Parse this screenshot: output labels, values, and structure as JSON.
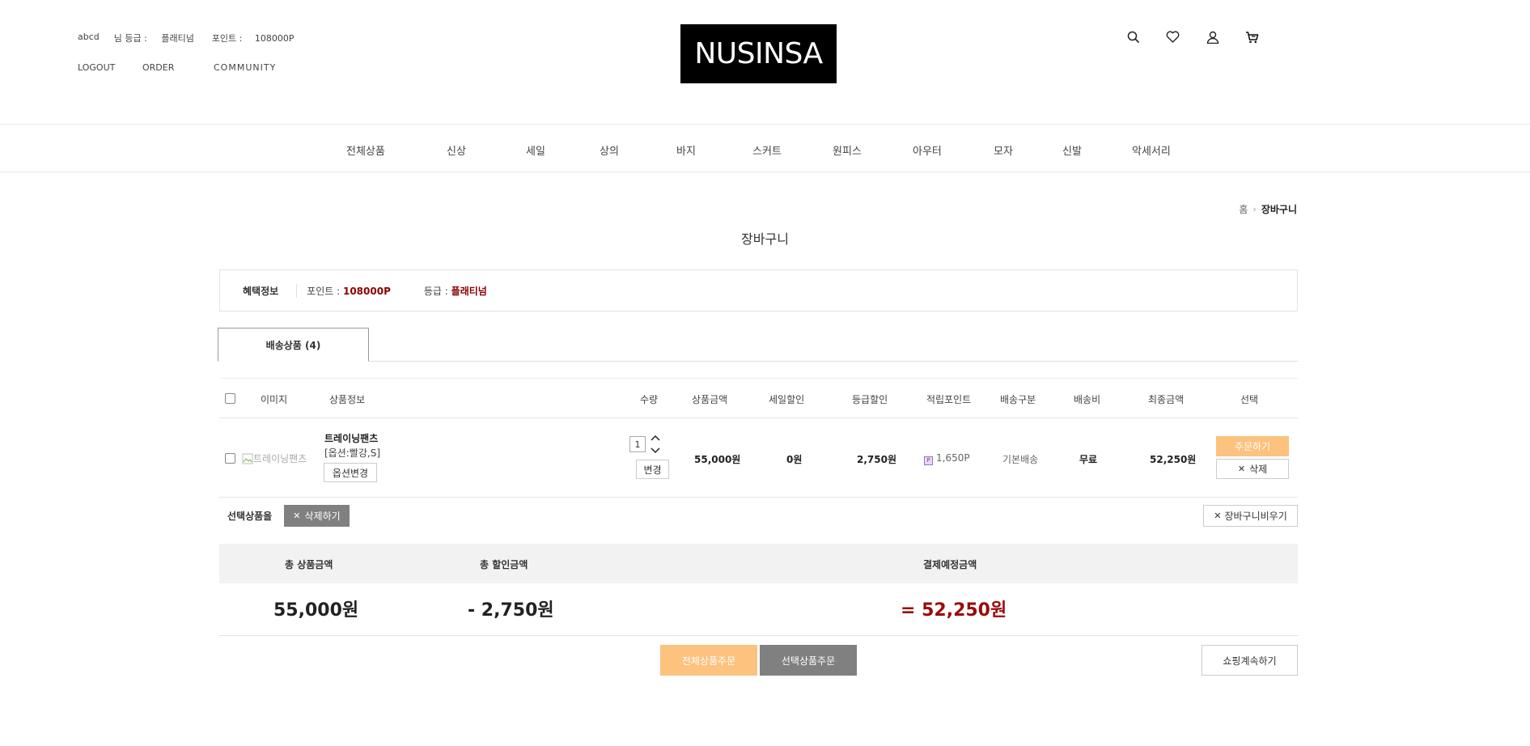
{
  "header": {
    "user_id": "abcd",
    "grade_label": "님 등급 :",
    "grade_value": "플래티넘",
    "point_label": "포인트 :",
    "point_value": "108000P",
    "logout": "LOGOUT",
    "order": "ORDER",
    "community": "COMMUNITY",
    "logo": "NUSINSA",
    "icons": [
      "search-icon",
      "heart-icon",
      "user-icon",
      "cart-icon"
    ]
  },
  "categories": [
    "전체상품",
    "신상",
    "세일",
    "상의",
    "바지",
    "스커트",
    "원피스",
    "아우터",
    "모자",
    "신발",
    "악세서리"
  ],
  "breadcrumb": {
    "home": "홈",
    "current": "장바구니"
  },
  "page_title": "장바구니",
  "benefit": {
    "label": "혜택정보",
    "point_label": "포인트 :",
    "point_value": "108000P",
    "grade_label": "등급 :",
    "grade_value": "플래티넘"
  },
  "tab": {
    "label": "배송상품 (4)"
  },
  "table": {
    "headers": [
      "이미지",
      "상품정보",
      "수량",
      "상품금액",
      "세일할인",
      "등급할인",
      "적립포인트",
      "배송구분",
      "배송비",
      "최종금액",
      "선택"
    ],
    "rows": [
      {
        "image_alt": "트레이닝팬츠",
        "name": "트레이닝팬츠",
        "option": "[옵션:빨강,S]",
        "option_button": "옵션변경",
        "quantity": "1",
        "qty_change_button": "변경",
        "price": "55,000원",
        "sale_discount": "0원",
        "grade_discount": "2,750원",
        "points": "1,650P",
        "shipping_type": "기본배송",
        "shipping_fee": "무료",
        "final_price": "52,250원",
        "order_button": "주문하기",
        "delete_button": "삭제"
      }
    ]
  },
  "selected_actions": {
    "label": "선택상품을",
    "delete_button": "삭제하기",
    "empty_button": "장바구니비우기"
  },
  "summary": {
    "total_label": "총 상품금액",
    "discount_label": "총 할인금액",
    "pay_label": "결제예정금액",
    "total_value": "55,000원",
    "discount_value": "- 2,750원",
    "pay_value": "= 52,250원"
  },
  "bottom": {
    "all_order": "전체상품주문",
    "selected_order": "선택상품주문",
    "continue": "쇼핑계속하기"
  },
  "colors": {
    "accent_orange": "#fcc27e",
    "button_grey": "#808080",
    "highlight_red": "#9b0a0a"
  }
}
